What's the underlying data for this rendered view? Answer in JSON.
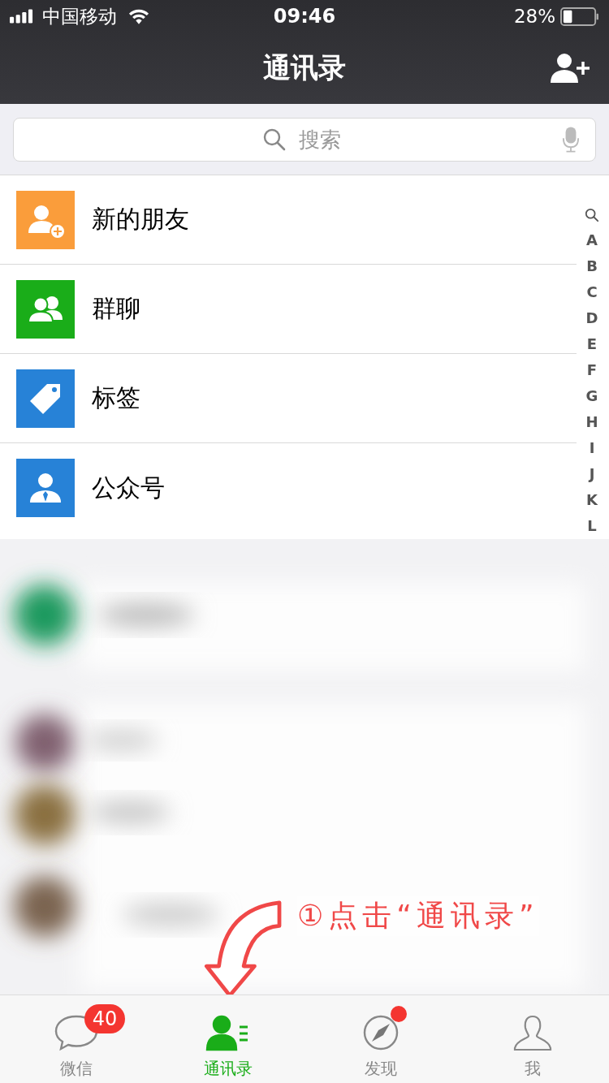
{
  "status_bar": {
    "carrier": "中国移动",
    "time": "09:46",
    "battery": "28%"
  },
  "nav": {
    "title": "通讯录"
  },
  "search": {
    "placeholder": "搜索"
  },
  "menu": [
    {
      "kind": "new_friends",
      "label": "新的朋友",
      "color": "#fa9d3b"
    },
    {
      "kind": "group_chat",
      "label": "群聊",
      "color": "#1aad19"
    },
    {
      "kind": "tags",
      "label": "标签",
      "color": "#2782d7"
    },
    {
      "kind": "official_accounts",
      "label": "公众号",
      "color": "#2782d7"
    }
  ],
  "index": [
    "A",
    "B",
    "C",
    "D",
    "E",
    "F",
    "G",
    "H",
    "I",
    "J",
    "K",
    "L"
  ],
  "annotation": "①点击“通讯录”",
  "tabs": [
    {
      "kind": "chats",
      "label": "微信",
      "selected": false,
      "badge": "40",
      "dot": false
    },
    {
      "kind": "contacts",
      "label": "通讯录",
      "selected": true,
      "dot": false
    },
    {
      "kind": "discover",
      "label": "发现",
      "selected": false,
      "dot": true
    },
    {
      "kind": "me",
      "label": "我",
      "selected": false,
      "dot": false
    }
  ]
}
